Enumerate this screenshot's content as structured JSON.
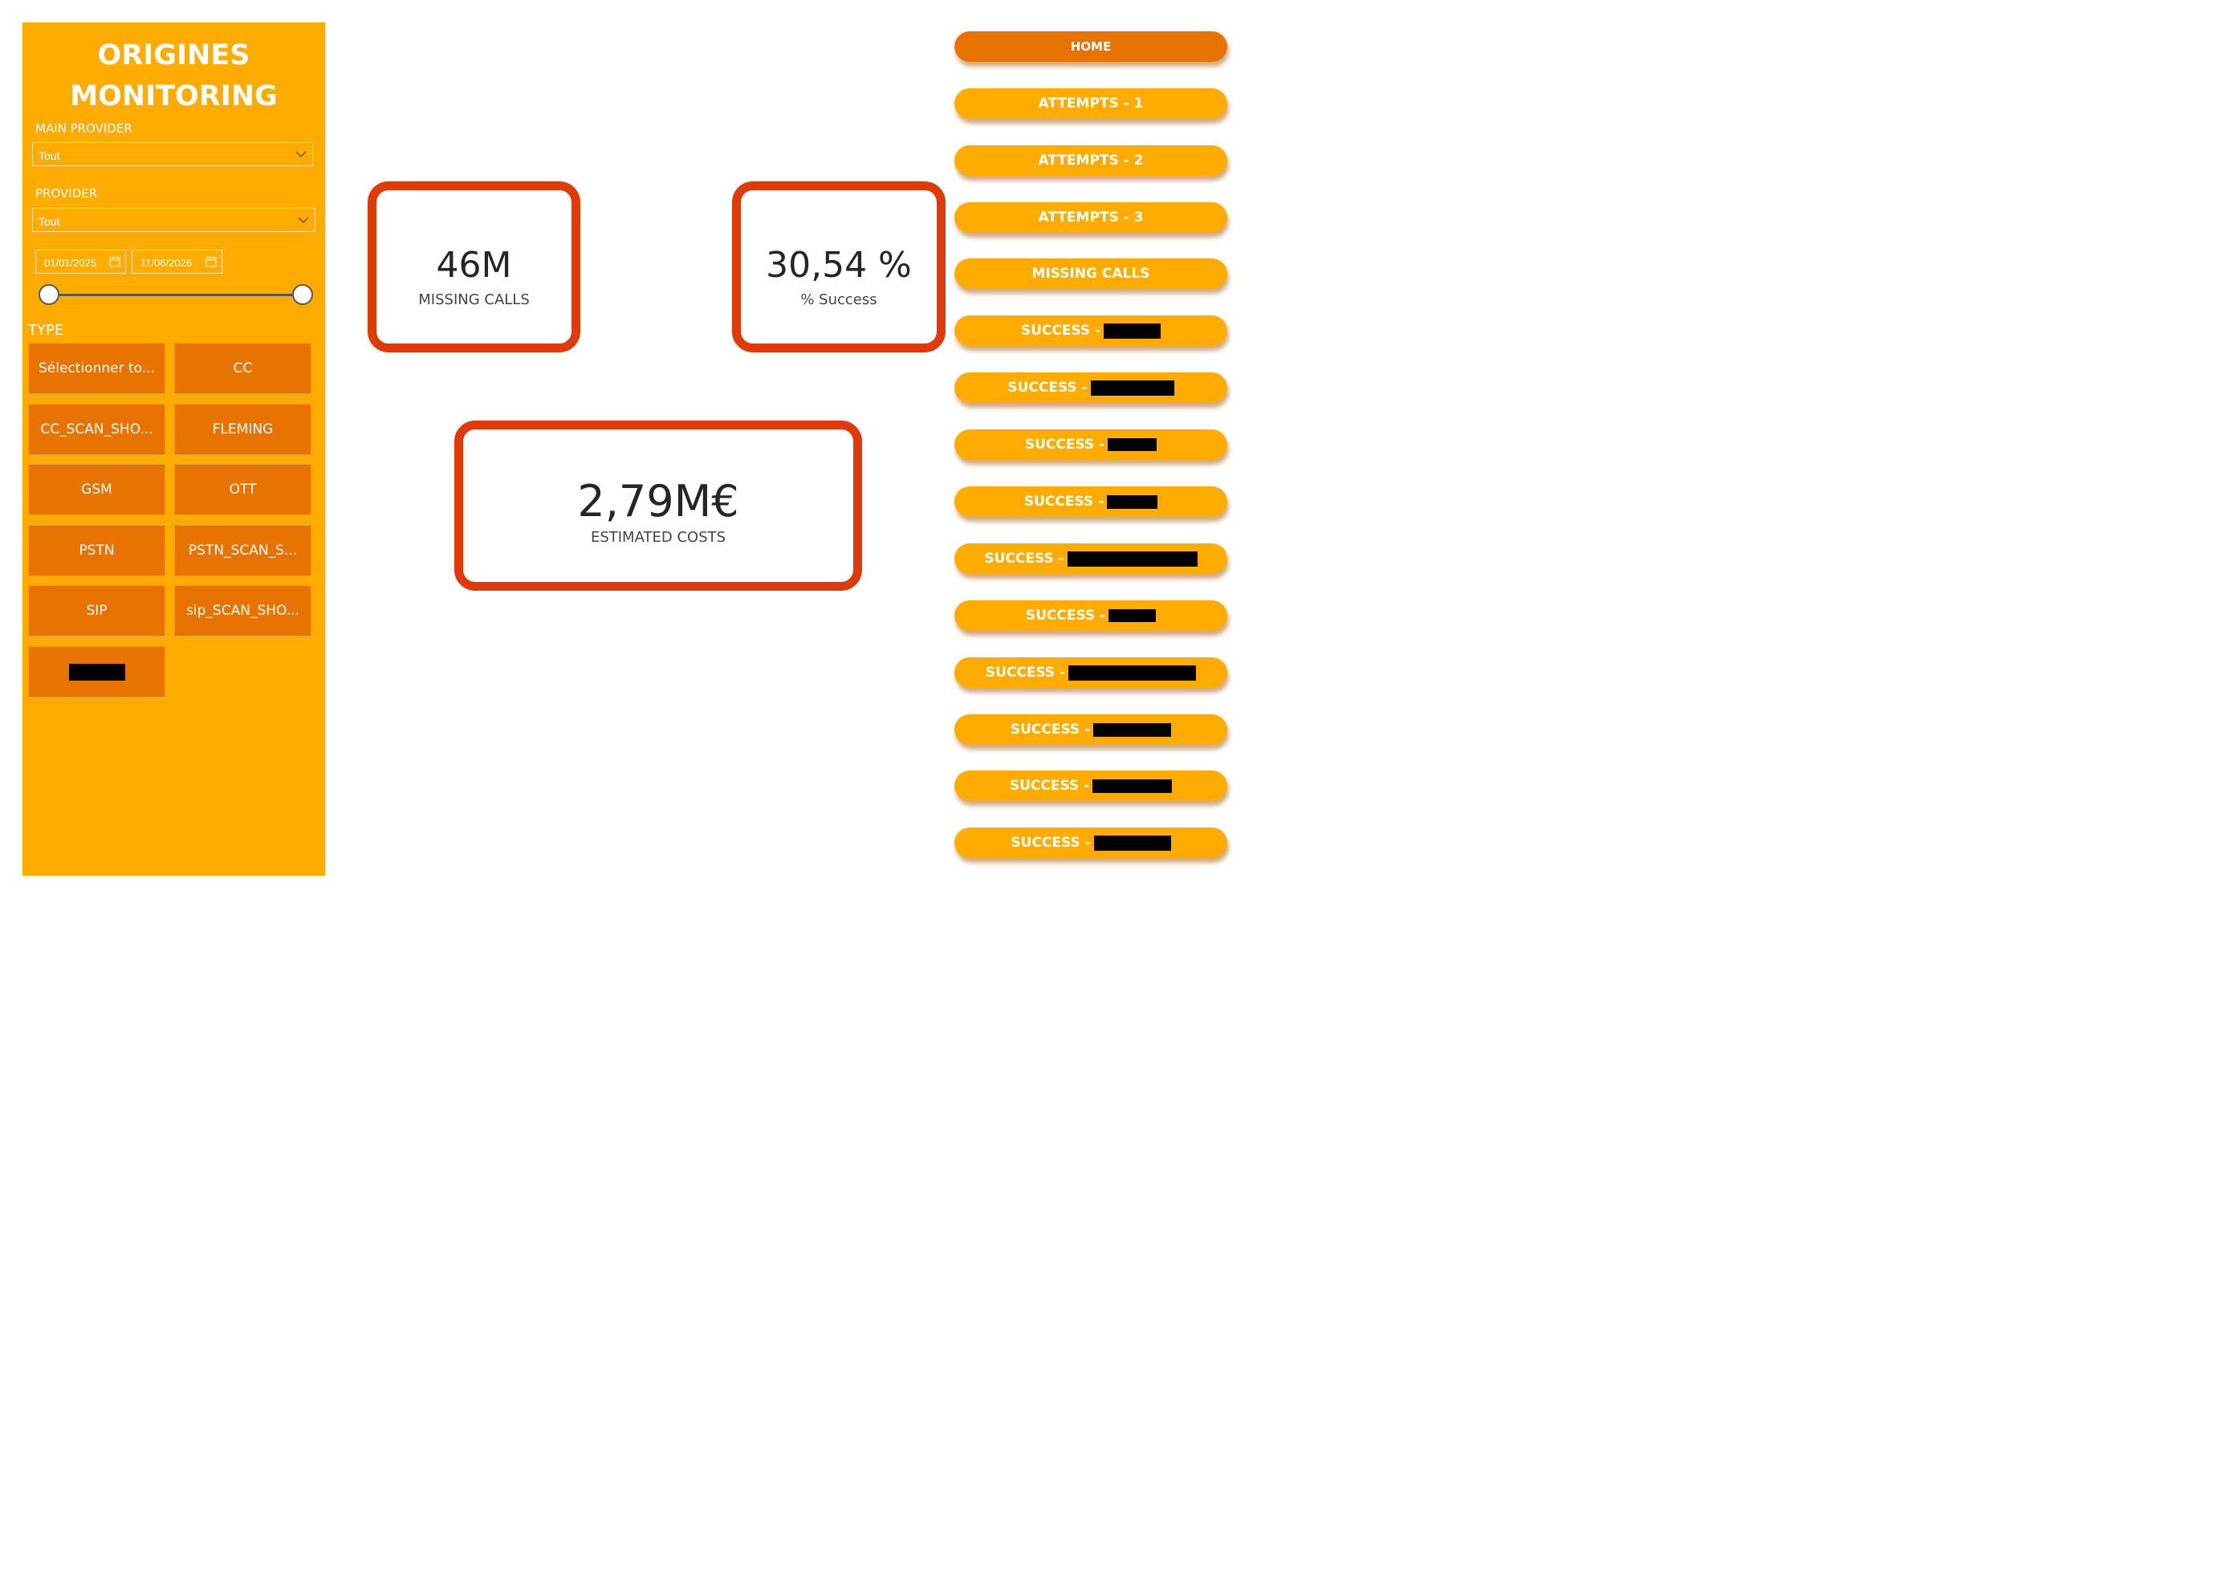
{
  "app": {
    "title_line1": "ORIGINES",
    "title_line2": "MONITORING"
  },
  "filters": {
    "main_provider": {
      "label": "MAIN PROVIDER",
      "value": "Tout"
    },
    "provider": {
      "label": "PROVIDER",
      "value": "Tout"
    },
    "date_range": {
      "start": "01/01/2025",
      "end": "11/06/2026"
    },
    "type": {
      "label": "TYPE",
      "options": [
        "Sélectionner to...",
        "CC",
        "CC_SCAN_SHO...",
        "FLEMING",
        "GSM",
        "OTT",
        "PSTN",
        "PSTN_SCAN_S...",
        "SIP",
        "sip_SCAN_SHO..."
      ]
    }
  },
  "kpis": {
    "missing_calls": {
      "value": "46M",
      "label": "MISSING CALLS"
    },
    "success_rate": {
      "value": "30,54 %",
      "label": "% Success"
    },
    "estimated_costs": {
      "value": "2,79M€",
      "label": "ESTIMATED COSTS"
    }
  },
  "nav": {
    "home": "HOME",
    "attempts_1": "ATTEMPTS - 1",
    "attempts_2": "ATTEMPTS - 2",
    "attempts_3": "ATTEMPTS - 3",
    "missing_calls": "MISSING CALLS",
    "success_prefix": "SUCCESS -"
  },
  "colors": {
    "sidebar_bg": "#FFAB00",
    "button_dark": "#E87300",
    "card_border": "#E03A0B"
  }
}
